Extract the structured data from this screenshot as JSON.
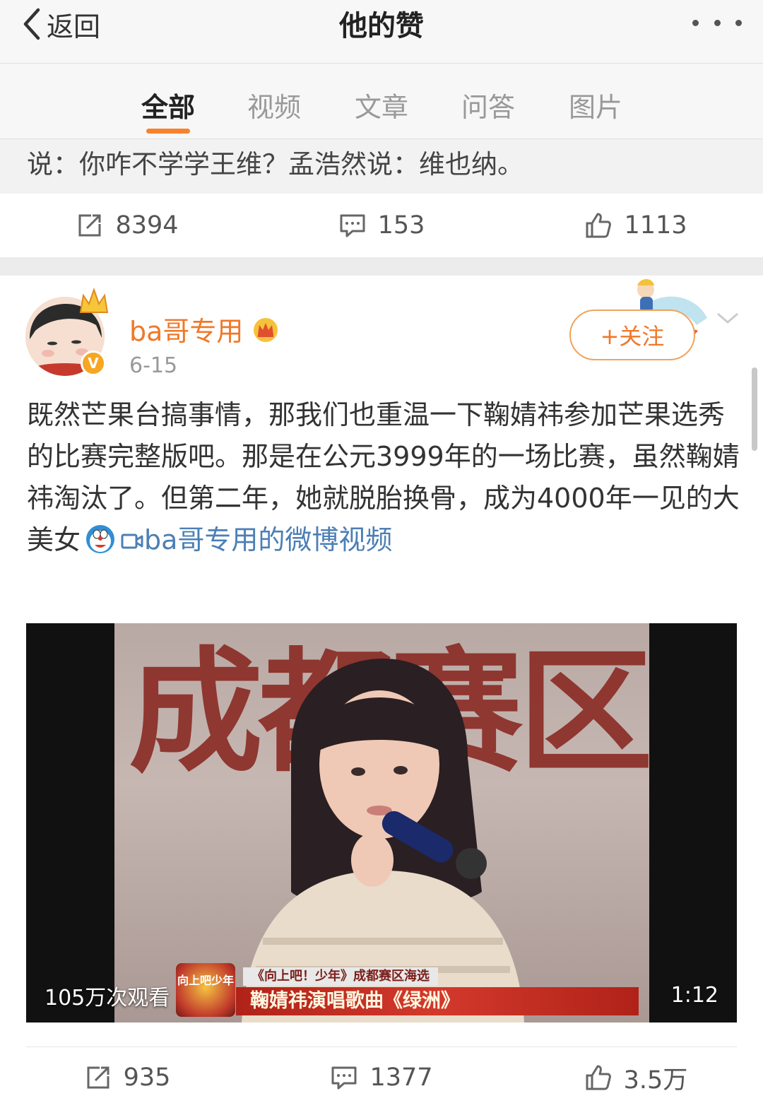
{
  "nav": {
    "back_label": "返回",
    "title": "他的赞"
  },
  "tabs": [
    {
      "label": "全部",
      "active": true
    },
    {
      "label": "视频",
      "active": false
    },
    {
      "label": "文章",
      "active": false
    },
    {
      "label": "问答",
      "active": false
    },
    {
      "label": "图片",
      "active": false
    }
  ],
  "prev_post": {
    "text_tail": "说：你咋不学学王维？孟浩然说：维也纳。",
    "reposts": "8394",
    "comments": "153",
    "likes": "1113"
  },
  "post": {
    "username": "ba哥专用",
    "date": "6-15",
    "follow_label": "+关注",
    "verified_badge": "V",
    "text": "既然芒果台搞事情，那我们也重温一下鞠婧祎参加芒果选秀的比赛完整版吧。那是在公元3999年的一场比赛，虽然鞠婧祎淘汰了。但第二年，她就脱胎换骨，成为4000年一见的大美女",
    "video_link_label": "ba哥专用的微博视频",
    "video": {
      "banner_text": "成都赛区",
      "caption_top": "《向上吧！少年》成都赛区海选",
      "caption_main": "鞠婧祎演唱歌曲《绿洲》",
      "caption_logo": "向上吧少年",
      "view_count": "105万次观看",
      "duration": "1:12"
    },
    "reposts": "935",
    "comments": "1377",
    "likes": "3.5万"
  },
  "colors": {
    "accent": "#f7822e",
    "username": "#f0782a",
    "link": "#4c7fb5"
  },
  "icons": [
    "chevron-left-icon",
    "more-dots-icon",
    "repost-icon",
    "comment-icon",
    "like-icon",
    "crown-icon",
    "video-link-icon",
    "doraemon-emoji-icon",
    "chevron-down-icon"
  ]
}
